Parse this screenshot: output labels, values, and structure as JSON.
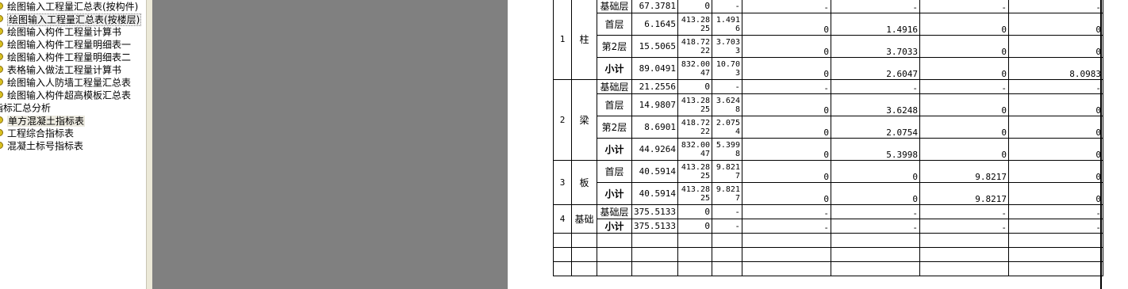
{
  "tree": {
    "items": [
      {
        "label": "绘图输入工程量汇总表(按构件)",
        "icon": "report-node-icon",
        "state": "normal"
      },
      {
        "label": "绘图输入工程量汇总表(按楼层)",
        "icon": "report-node-icon",
        "state": "focused"
      },
      {
        "label": "绘图输入构件工程量计算书",
        "icon": "report-node-icon",
        "state": "normal"
      },
      {
        "label": "绘图输入构件工程量明细表一",
        "icon": "report-node-icon",
        "state": "normal"
      },
      {
        "label": "绘图输入构件工程量明细表二",
        "icon": "report-node-icon",
        "state": "normal"
      },
      {
        "label": "表格输入做法工程量计算书",
        "icon": "report-node-icon",
        "state": "normal"
      },
      {
        "label": "绘图输入人防墙工程量汇总表",
        "icon": "report-node-icon",
        "state": "normal"
      },
      {
        "label": "绘图输入构件超高模板汇总表",
        "icon": "report-node-icon",
        "state": "normal"
      }
    ],
    "group": {
      "label": "指标汇总分析"
    },
    "group_items": [
      {
        "label": "单方混凝土指标表",
        "icon": "report-node-icon",
        "state": "selected"
      },
      {
        "label": "工程综合指标表",
        "icon": "report-node-icon",
        "state": "normal"
      },
      {
        "label": "混凝土标号指标表",
        "icon": "report-node-icon",
        "state": "normal"
      }
    ]
  },
  "report": {
    "groups": [
      {
        "no": "1",
        "name": "柱",
        "rows": [
          {
            "floor": "基础层",
            "v1": "67.3781",
            "v2": "0",
            "v3": "-",
            "v4": "-",
            "v5": "-",
            "v6": "-",
            "v7": "-"
          },
          {
            "floor": "首层",
            "v1": "6.1645",
            "v2": "413.2825",
            "v3": "1.4916",
            "v4": "0",
            "v5": "1.4916",
            "v6": "0",
            "v7": "0"
          },
          {
            "floor": "第2层",
            "v1": "15.5065",
            "v2": "418.7222",
            "v3": "3.7033",
            "v4": "0",
            "v5": "3.7033",
            "v6": "0",
            "v7": "0"
          },
          {
            "floor": "小计",
            "v1": "89.0491",
            "v2": "832.0047",
            "v3": "10.703",
            "v4": "0",
            "v5": "2.6047",
            "v6": "0",
            "v7": "8.0983"
          }
        ]
      },
      {
        "no": "2",
        "name": "梁",
        "rows": [
          {
            "floor": "基础层",
            "v1": "21.2556",
            "v2": "0",
            "v3": "-",
            "v4": "-",
            "v5": "-",
            "v6": "-",
            "v7": "-"
          },
          {
            "floor": "首层",
            "v1": "14.9807",
            "v2": "413.2825",
            "v3": "3.6248",
            "v4": "0",
            "v5": "3.6248",
            "v6": "0",
            "v7": "0"
          },
          {
            "floor": "第2层",
            "v1": "8.6901",
            "v2": "418.7222",
            "v3": "2.0754",
            "v4": "0",
            "v5": "2.0754",
            "v6": "0",
            "v7": "0"
          },
          {
            "floor": "小计",
            "v1": "44.9264",
            "v2": "832.0047",
            "v3": "5.3998",
            "v4": "0",
            "v5": "5.3998",
            "v6": "0",
            "v7": "0"
          }
        ]
      },
      {
        "no": "3",
        "name": "板",
        "rows": [
          {
            "floor": "首层",
            "v1": "40.5914",
            "v2": "413.2825",
            "v3": "9.8217",
            "v4": "0",
            "v5": "0",
            "v6": "9.8217",
            "v7": "0"
          },
          {
            "floor": "小计",
            "v1": "40.5914",
            "v2": "413.2825",
            "v3": "9.8217",
            "v4": "0",
            "v5": "0",
            "v6": "9.8217",
            "v7": "0"
          }
        ]
      },
      {
        "no": "4",
        "name": "基础",
        "rows": [
          {
            "floor": "基础层",
            "v1": "375.5133",
            "v2": "0",
            "v3": "-",
            "v4": "-",
            "v5": "-",
            "v6": "-",
            "v7": "-"
          },
          {
            "floor": "小计",
            "v1": "375.5133",
            "v2": "0",
            "v3": "-",
            "v4": "-",
            "v5": "-",
            "v6": "-",
            "v7": "-"
          }
        ]
      }
    ]
  }
}
